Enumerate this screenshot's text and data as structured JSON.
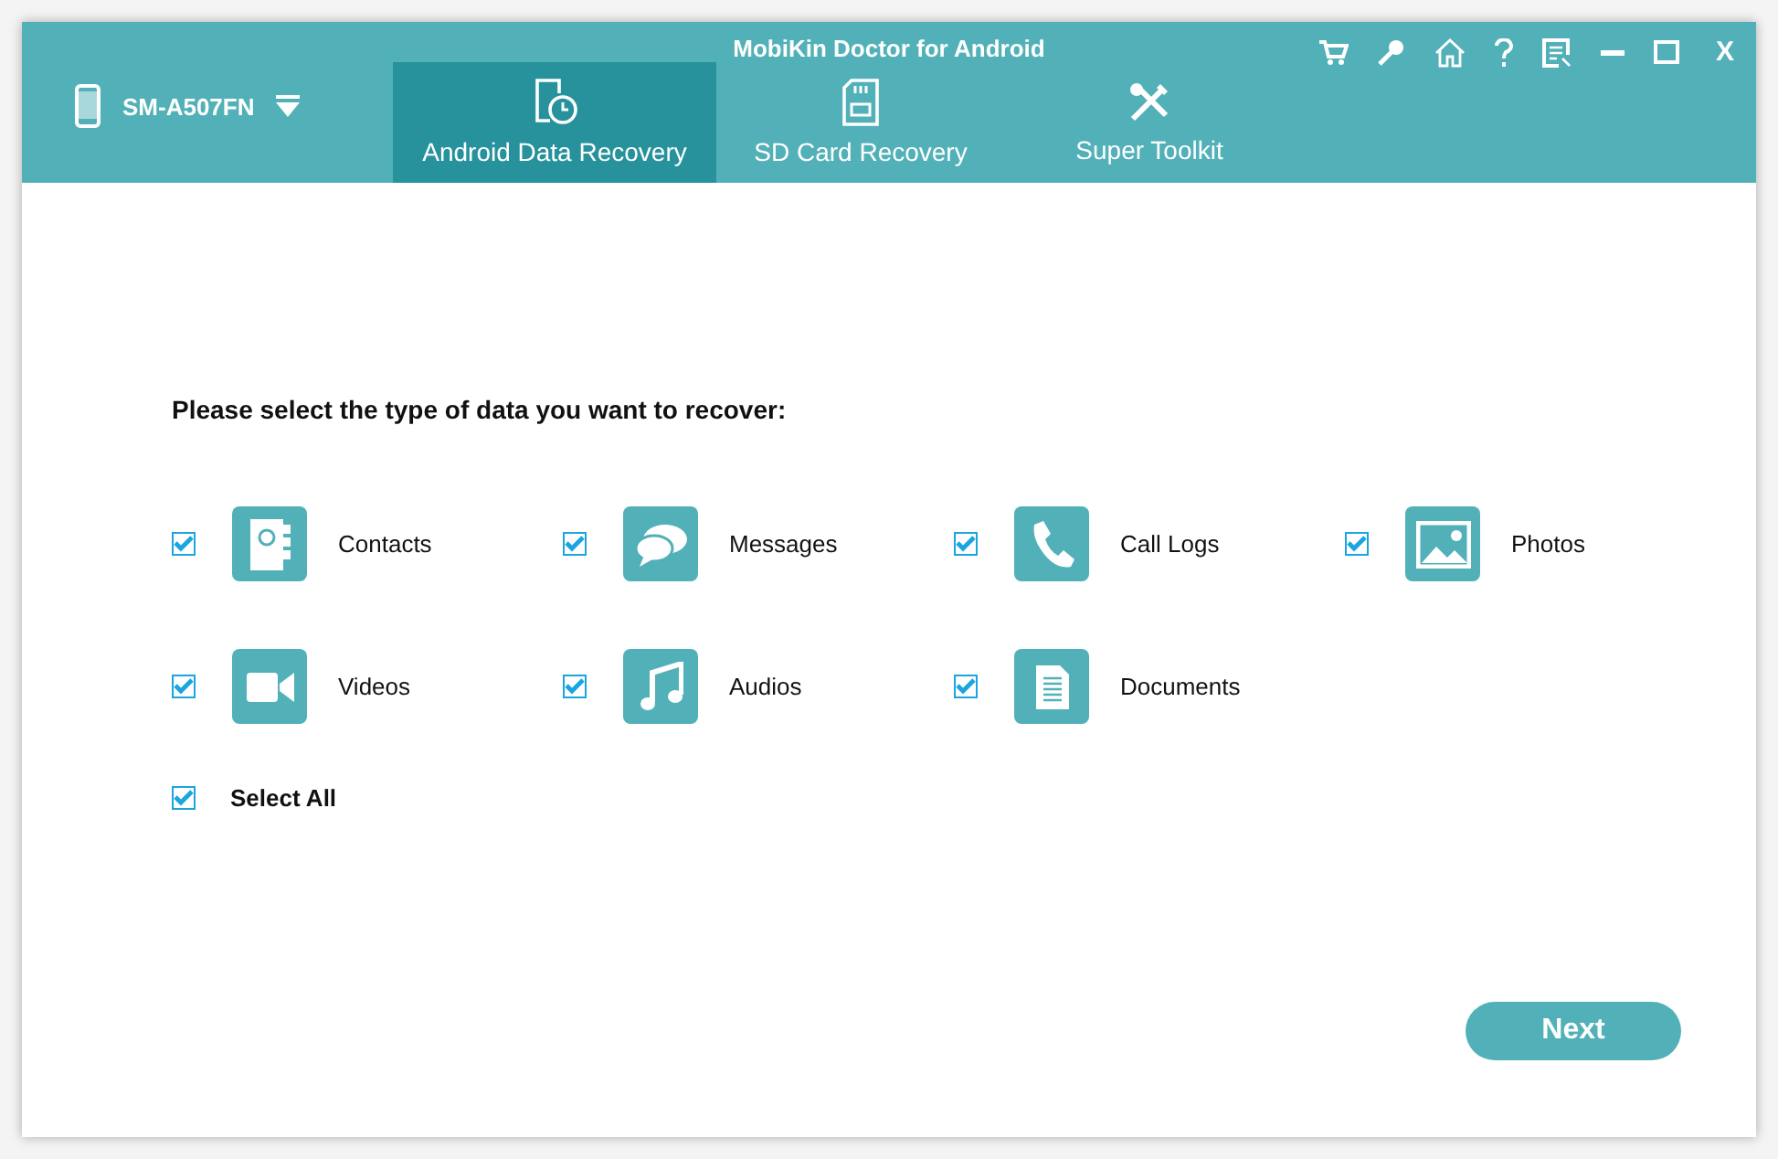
{
  "window": {
    "title": "MobiKin Doctor for Android",
    "close_label": "X"
  },
  "device": {
    "name": "SM-A507FN"
  },
  "tabs": [
    {
      "label": "Android Data Recovery",
      "kind": "recovery",
      "selected": true
    },
    {
      "label": "SD Card Recovery",
      "kind": "sdcard",
      "selected": false
    },
    {
      "label": "Super Toolkit",
      "kind": "toolkit",
      "selected": false
    }
  ],
  "prompt": "Please select the type of data you want to recover:",
  "data_types": [
    {
      "label": "Contacts",
      "kind": "contacts",
      "checked": true
    },
    {
      "label": "Messages",
      "kind": "messages",
      "checked": true
    },
    {
      "label": "Call Logs",
      "kind": "calllogs",
      "checked": true
    },
    {
      "label": "Photos",
      "kind": "photos",
      "checked": true
    },
    {
      "label": "Videos",
      "kind": "videos",
      "checked": true
    },
    {
      "label": "Audios",
      "kind": "audios",
      "checked": true
    },
    {
      "label": "Documents",
      "kind": "documents",
      "checked": true
    }
  ],
  "select_all": {
    "label": "Select All",
    "checked": true
  },
  "next_button": "Next"
}
